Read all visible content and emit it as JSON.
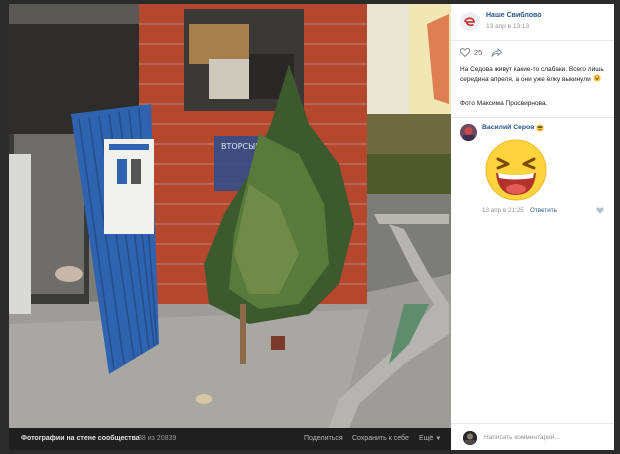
{
  "photo_bar": {
    "album_label": "Фотографии на стене сообщества",
    "counter": "38 из 20839",
    "share_label": "Поделиться",
    "save_label": "Сохранить к себе",
    "more_label": "Ещё"
  },
  "post": {
    "community_name": "Наше Свиблово",
    "date": "13 апр в 13:13",
    "likes_count": "25",
    "text": "На Седова живут какие-то слабаки. Всего лишь середина апреля, а они уже ёлку выкинули",
    "credit": "Фото Максима Просвирнова."
  },
  "comment": {
    "author": "Василий Серов",
    "date": "13 апр в 21:25",
    "reply_label": "Ответить"
  },
  "composer": {
    "placeholder": "Написать комментарий..."
  },
  "photo_signage": {
    "bin_label": "ВТОРСЫРЬЁ"
  },
  "colors": {
    "link": "#2a5885",
    "muted": "#939393",
    "viewer_bg": "#2b2b2b"
  },
  "icons": [
    "heart-icon",
    "share-arrow-icon",
    "laughing-emoji-icon",
    "smile-emoji-icon",
    "like-heart-small-icon"
  ]
}
